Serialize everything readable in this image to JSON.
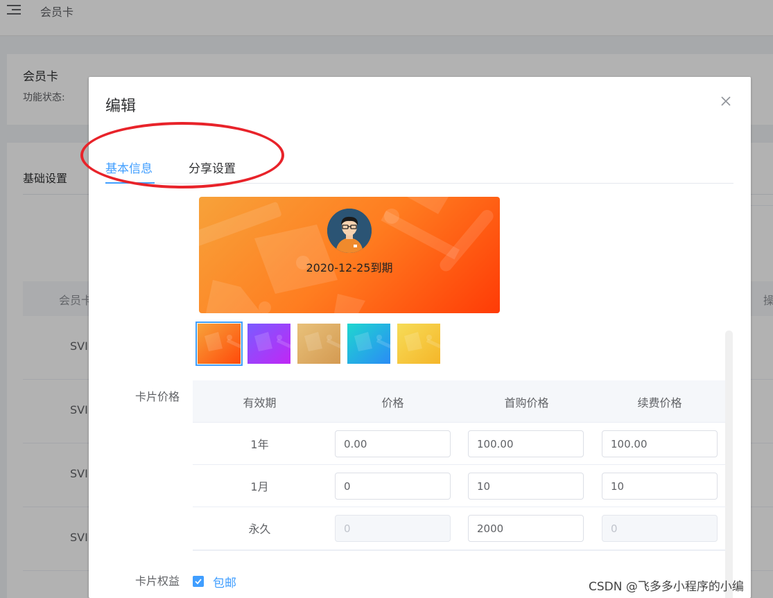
{
  "background": {
    "header_title": "会员卡",
    "card_title": "会员卡",
    "status_label": "功能状态:",
    "tab_label": "基础设置",
    "table_head_left": "会员卡",
    "table_head_right": "操",
    "row_prefix": "SVI"
  },
  "dialog": {
    "title": "编辑",
    "tabs": [
      {
        "label": "基本信息",
        "active": true
      },
      {
        "label": "分享设置",
        "active": false
      }
    ],
    "card_preview": {
      "expire_text": "2020-12-25到期"
    },
    "theme_swatches": [
      {
        "name": "orange",
        "from": "#f7a23a",
        "to": "#ff4a0a",
        "selected": true
      },
      {
        "name": "purple",
        "from": "#7a5cff",
        "to": "#c027f5",
        "selected": false
      },
      {
        "name": "tan",
        "from": "#e8c17a",
        "to": "#d49a52",
        "selected": false
      },
      {
        "name": "cyan",
        "from": "#1fd6cf",
        "to": "#2a8cf5",
        "selected": false
      },
      {
        "name": "yellow",
        "from": "#f6dc58",
        "to": "#f5b629",
        "selected": false
      }
    ],
    "price_label": "卡片价格",
    "price_table": {
      "headers": [
        "有效期",
        "价格",
        "首购价格",
        "续费价格"
      ],
      "rows": [
        {
          "period": "1年",
          "price": "0.00",
          "first_price": "100.00",
          "renew_price": "100.00",
          "price_disabled": false,
          "renew_disabled": false
        },
        {
          "period": "1月",
          "price": "0",
          "first_price": "10",
          "renew_price": "10",
          "price_disabled": false,
          "renew_disabled": false
        },
        {
          "period": "永久",
          "price": "0",
          "first_price": "2000",
          "renew_price": "0",
          "price_disabled": true,
          "renew_disabled": true
        }
      ]
    },
    "benefits_label": "卡片权益",
    "benefit_option": {
      "label": "包邮",
      "checked": true
    }
  },
  "watermark": "CSDN @飞多多小程序的小编",
  "colors": {
    "primary": "#409eff",
    "annotation": "#e8232a",
    "overlay": "rgba(0,0,0,0.3)"
  }
}
